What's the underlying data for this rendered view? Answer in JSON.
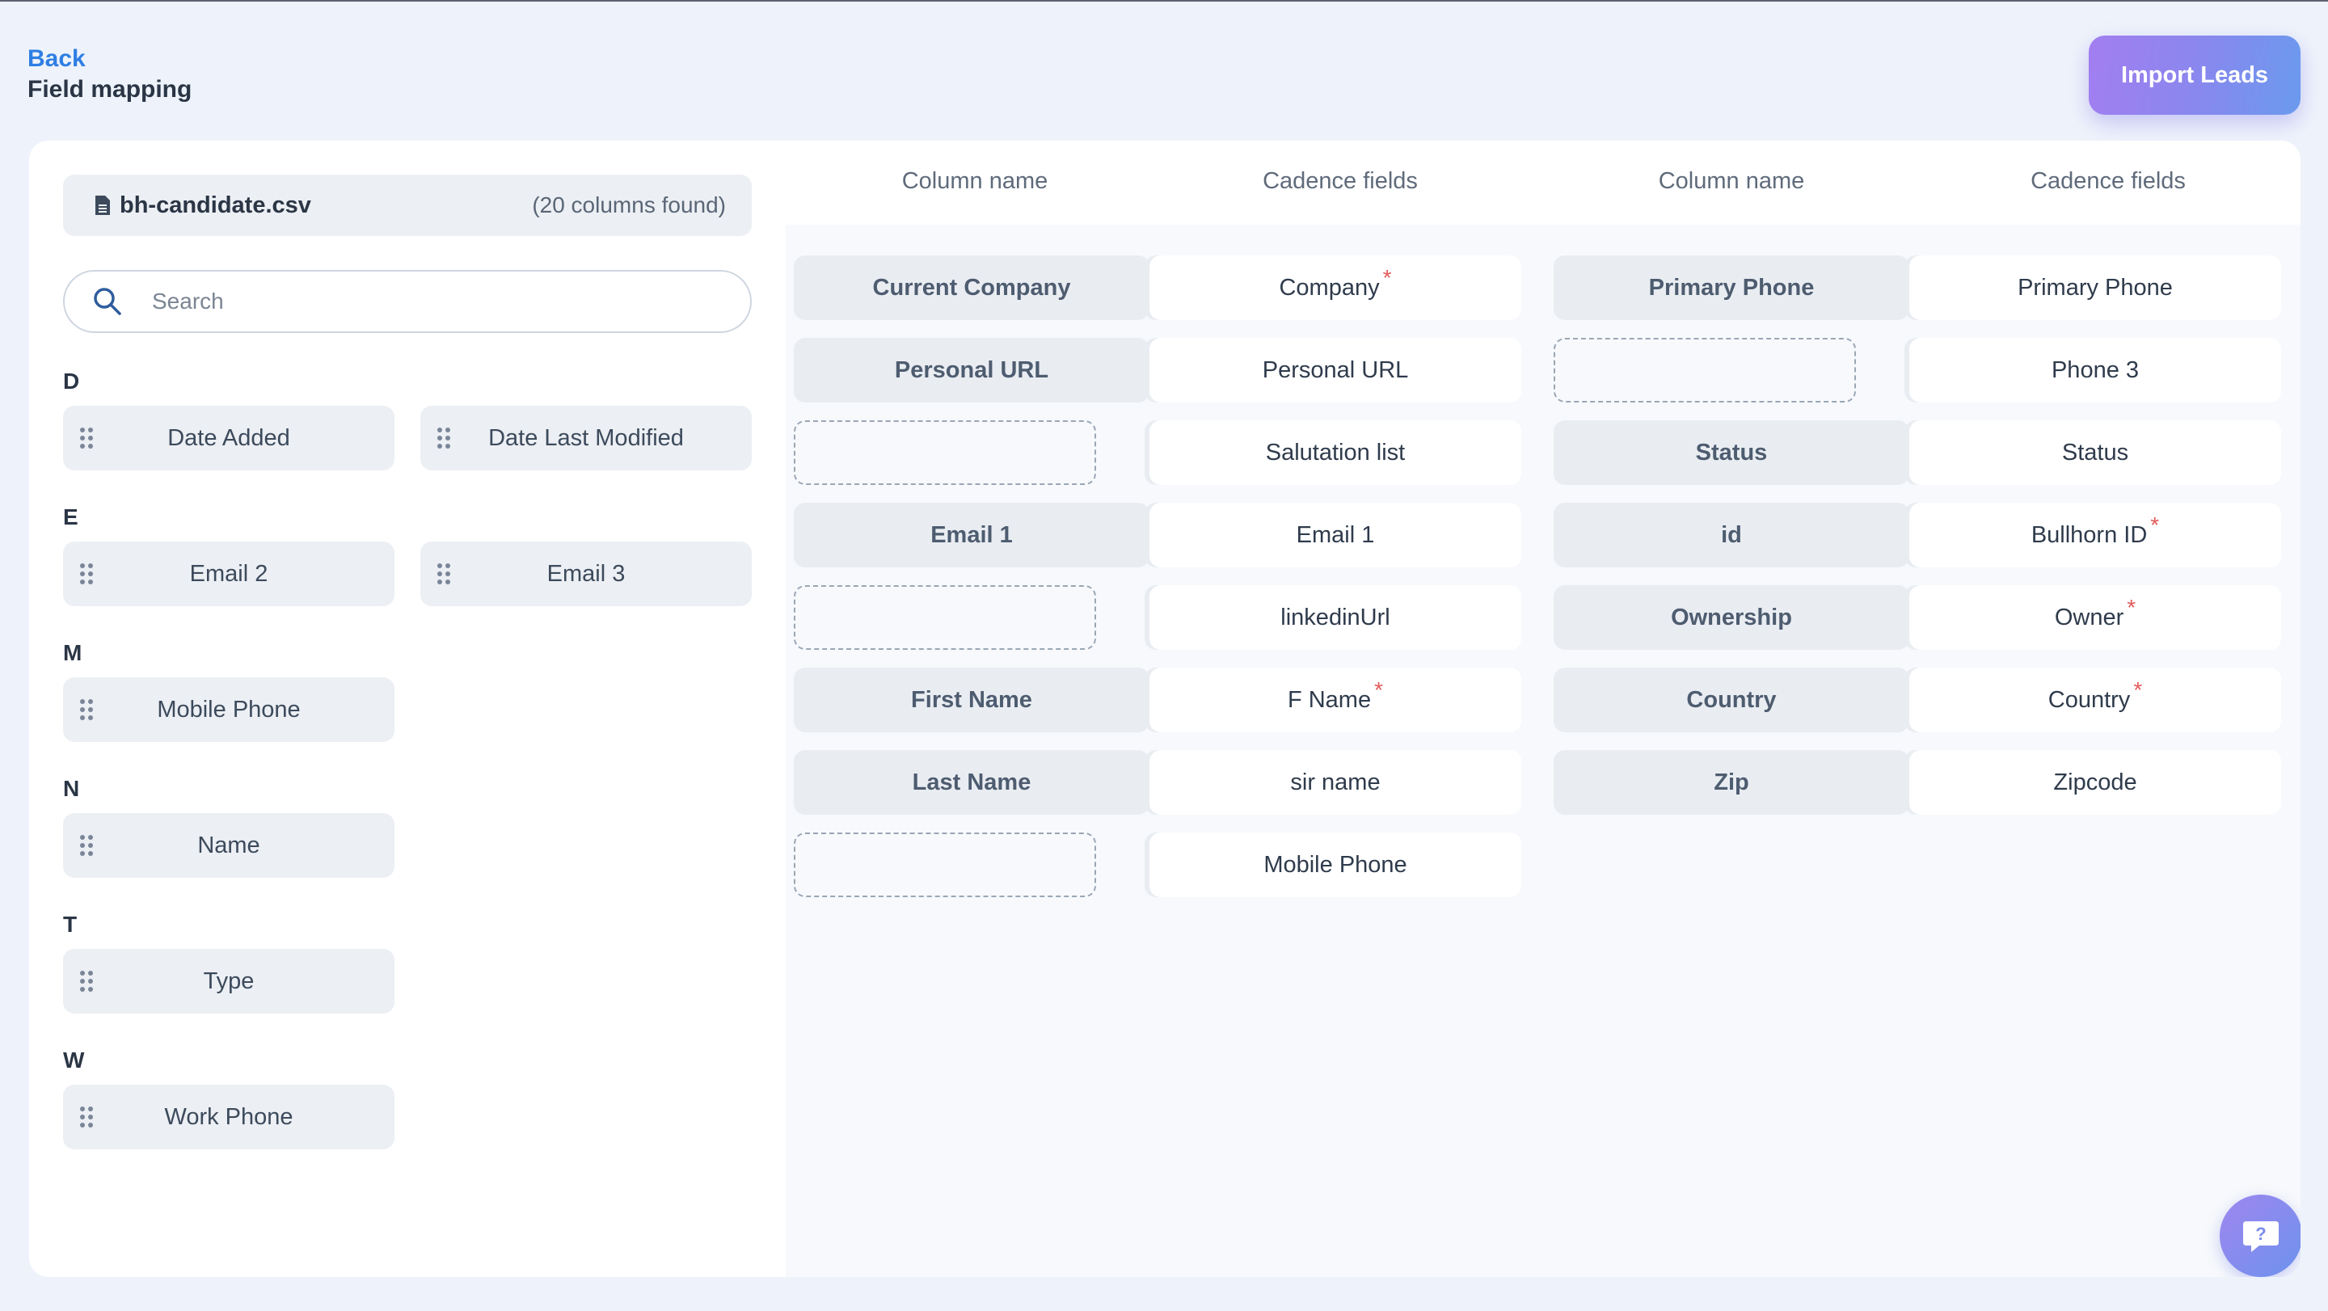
{
  "header": {
    "back_label": "Back",
    "title": "Field mapping",
    "import_label": "Import Leads"
  },
  "file": {
    "name": "bh-candidate.csv",
    "count_text": "(20 columns found)"
  },
  "search": {
    "placeholder": "Search"
  },
  "groups": {
    "d": {
      "letter": "D",
      "fields": [
        "Date Added",
        "Date Last Modified"
      ]
    },
    "e": {
      "letter": "E",
      "fields": [
        "Email 2",
        "Email 3"
      ]
    },
    "m": {
      "letter": "M",
      "fields": [
        "Mobile Phone"
      ]
    },
    "n": {
      "letter": "N",
      "fields": [
        "Name"
      ]
    },
    "t": {
      "letter": "T",
      "fields": [
        "Type"
      ]
    },
    "w": {
      "letter": "W",
      "fields": [
        "Work Phone"
      ]
    }
  },
  "columns": {
    "column_name": "Column name",
    "cadence_fields": "Cadence fields"
  },
  "left_mappings": [
    {
      "column": "Current Company",
      "field": "Company",
      "required": true
    },
    {
      "column": "Personal URL",
      "field": "Personal URL",
      "required": false
    },
    {
      "column": "",
      "field": "Salutation list",
      "required": false
    },
    {
      "column": "Email 1",
      "field": "Email 1",
      "required": false
    },
    {
      "column": "",
      "field": "linkedinUrl",
      "required": false
    },
    {
      "column": "First Name",
      "field": "F Name",
      "required": true
    },
    {
      "column": "Last Name",
      "field": "sir name",
      "required": false
    },
    {
      "column": "",
      "field": "Mobile Phone",
      "required": false
    }
  ],
  "right_mappings": [
    {
      "column": "Primary Phone",
      "field": "Primary Phone",
      "required": false
    },
    {
      "column": "",
      "field": "Phone 3",
      "required": false
    },
    {
      "column": "Status",
      "field": "Status",
      "required": false
    },
    {
      "column": "id",
      "field": "Bullhorn ID",
      "required": true
    },
    {
      "column": "Ownership",
      "field": "Owner",
      "required": true
    },
    {
      "column": "Country",
      "field": "Country",
      "required": true
    },
    {
      "column": "Zip",
      "field": "Zipcode",
      "required": false
    }
  ],
  "required_marker": "*",
  "colors": {
    "accent": "#2f7fe3",
    "import_gradient_start": "#a37ef0",
    "import_gradient_end": "#6a9aee",
    "required": "#e35a5a"
  },
  "icons": {
    "file": "file-icon",
    "search": "search-icon",
    "grip": "drag-handle-icon",
    "help": "help-chat-icon"
  }
}
